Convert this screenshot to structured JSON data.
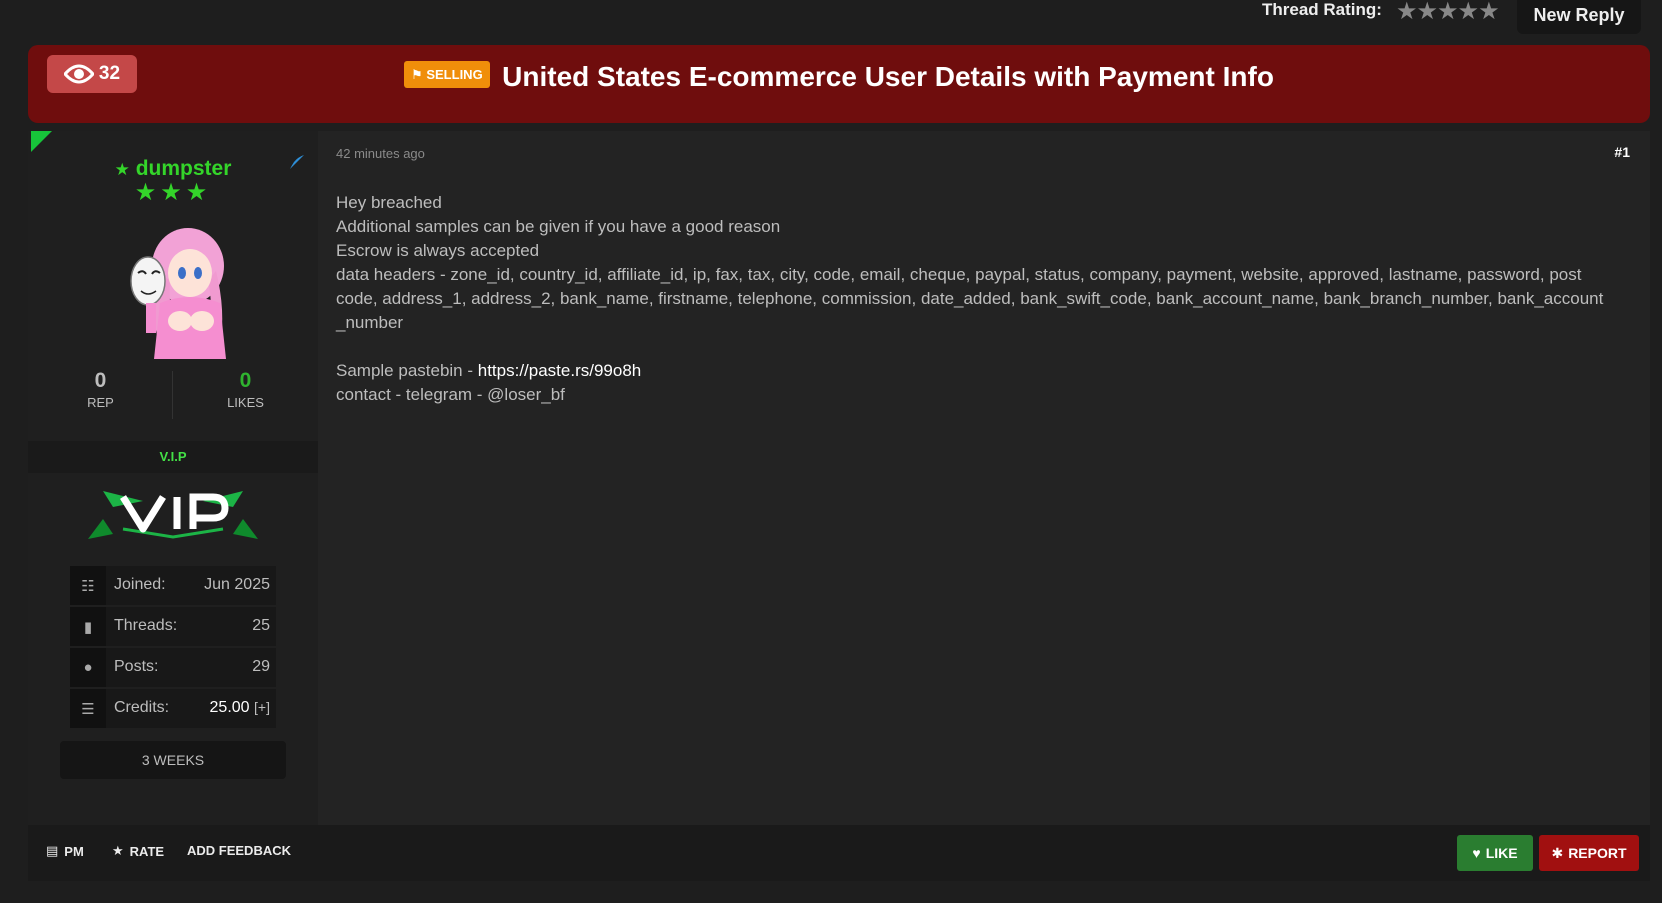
{
  "topbar": {
    "rating_label": "Thread Rating:",
    "stars": "★★★★★",
    "new_reply": "New Reply"
  },
  "thread": {
    "views": "32",
    "tag": "SELLING",
    "title": "United States E-commerce User Details with Payment Info"
  },
  "author": {
    "username": "dumpster",
    "stars": "★★★",
    "rep_value": "0",
    "rep_label": "REP",
    "likes_value": "0",
    "likes_label": "LIKES",
    "group": "V.I.P",
    "info": {
      "joined_label": "Joined:",
      "joined_value": "Jun 2025",
      "threads_label": "Threads:",
      "threads_value": "25",
      "posts_label": "Posts:",
      "posts_value": "29",
      "credits_label": "Credits:",
      "credits_value": "25.00",
      "credits_add": "[+]"
    },
    "membership": "3 WEEKS"
  },
  "post": {
    "time": "42 minutes ago",
    "number": "#1",
    "lines": [
      "Hey breached",
      "Additional samples can be given if you have a good reason",
      "Escrow is always accepted",
      "data headers - zone_id, country_id, affiliate_id, ip, fax, tax, city, code, email, cheque, paypal, status, company, payment, website, approved, lastname, password, post",
      "code, address_1, address_2, bank_name, firstname, telephone, commission, date_added, bank_swift_code, bank_account_name, bank_branch_number, bank_account",
      "_number"
    ],
    "sample_prefix": "Sample pastebin - ",
    "sample_link": "https://paste.rs/99o8h",
    "contact": "contact - telegram - @loser_bf"
  },
  "footer": {
    "pm": "PM",
    "rate": "RATE",
    "feedback": "ADD FEEDBACK",
    "like": "LIKE",
    "report": "REPORT"
  }
}
